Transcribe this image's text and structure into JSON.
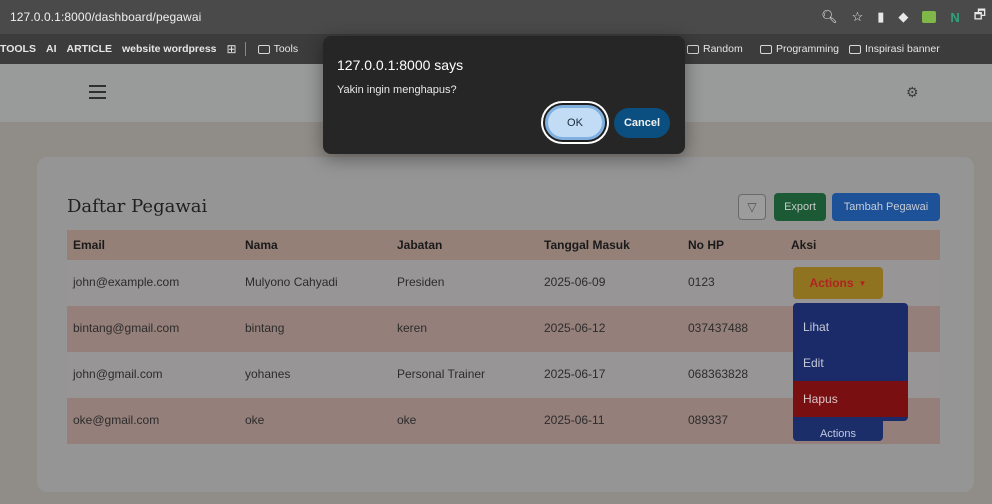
{
  "browser": {
    "url": "127.0.0.1:8000/dashboard/pegawai",
    "bookmarks_left": [
      {
        "label": "TOOLS",
        "bold": true
      },
      {
        "label": "AI",
        "bold": true
      },
      {
        "label": "ARTICLE",
        "bold": true
      },
      {
        "label": "website wordpress",
        "bold": true
      },
      {
        "label": "Tools",
        "bold": false
      }
    ],
    "bookmarks_right": [
      "Random",
      "Programming",
      "Inspirasi banner"
    ]
  },
  "dialog": {
    "title": "127.0.0.1:8000 says",
    "message": "Yakin ingin menghapus?",
    "ok_label": "OK",
    "cancel_label": "Cancel"
  },
  "page": {
    "title": "Daftar Pegawai",
    "filter_icon": "filter-icon",
    "export_label": "Export",
    "add_label": "Tambah Pegawai"
  },
  "table": {
    "headers": [
      "Email",
      "Nama",
      "Jabatan",
      "Tanggal Masuk",
      "No HP",
      "Aksi"
    ],
    "rows": [
      {
        "email": "john@example.com",
        "nama": "Mulyono Cahyadi",
        "jabatan": "Presiden",
        "tanggal": "2025-06-09",
        "hp": "0123"
      },
      {
        "email": "bintang@gmail.com",
        "nama": "bintang",
        "jabatan": "keren",
        "tanggal": "2025-06-12",
        "hp": "037437488"
      },
      {
        "email": "john@gmail.com",
        "nama": "yohanes",
        "jabatan": "Personal Trainer",
        "tanggal": "2025-06-17",
        "hp": "068363828"
      },
      {
        "email": "oke@gmail.com",
        "nama": "oke",
        "jabatan": "oke",
        "tanggal": "2025-06-11",
        "hp": "089337"
      }
    ],
    "actions_label": "Actions",
    "dropdown": [
      "Lihat",
      "Edit",
      "Hapus"
    ]
  },
  "colors": {
    "ok_accent": "#c1dcf4",
    "cancel_bg": "#0b4f80",
    "hapus_bg": "#7a0f12",
    "dropdown_bg": "#1b2b6a"
  }
}
